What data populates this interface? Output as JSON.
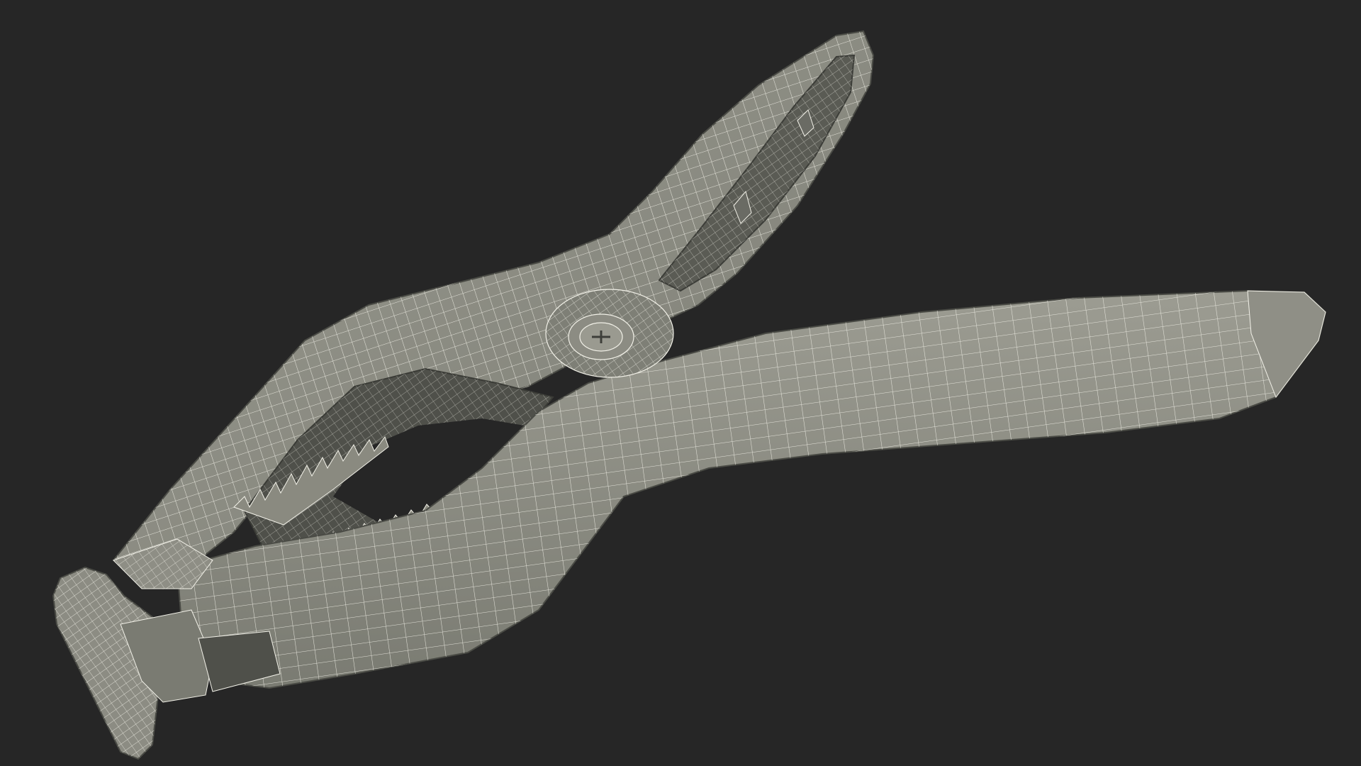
{
  "scene": {
    "subject": "spring clamp",
    "render_style": "wireframe over solid shaded mesh",
    "background_color": "#262626",
    "mesh_fill_color": "#8d8d84",
    "mesh_dark_color": "#54554e",
    "wire_color": "#f2f1e8"
  }
}
